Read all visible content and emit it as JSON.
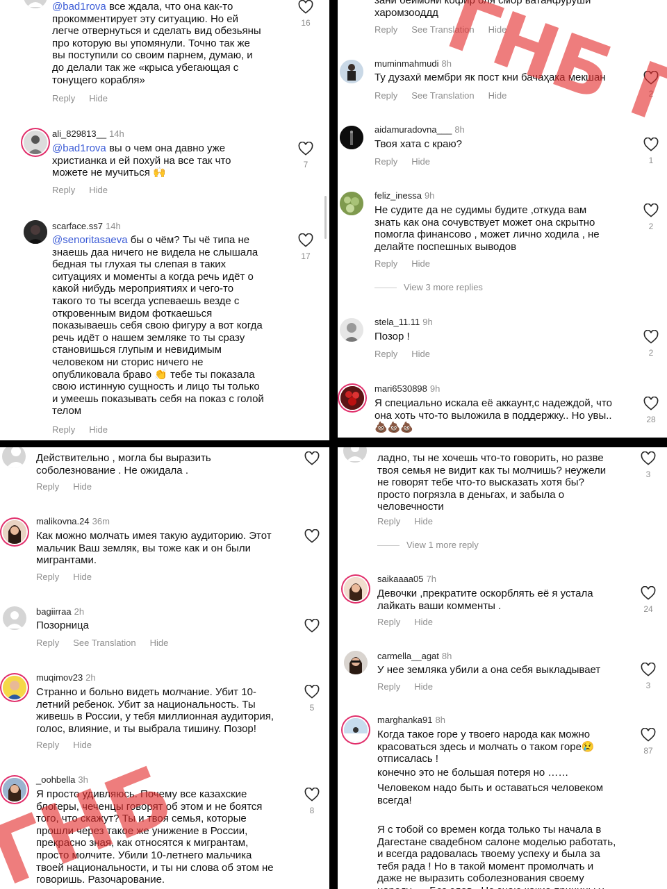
{
  "common": {
    "reply": "Reply",
    "hide": "Hide",
    "see_translation": "See Translation"
  },
  "p1": {
    "c1": {
      "mention": "@bad1rova",
      "text": " все ждала, что она как-то\nпрокомментирует эту ситуацию.  Но ей\nлегче отвернуться и сделать вид обезьяны\nпро которую вы упомянули. Точно так же\nвы поступили со своим парнем, думаю, и\nдо делали так же «крыса убегающая с\nтонущего корабля»",
      "likes": "16"
    },
    "c2": {
      "user": "ali_829813__",
      "time": "14h",
      "mention": "@bad1rova",
      "text": " вы о чем она давно уже\nхристианка и ей похуй на все так что\nможете не мучиться 🙌",
      "likes": "7"
    },
    "c3": {
      "user": "scarface.ss7",
      "time": "14h",
      "mention": "@senoritasaeva",
      "text": " бы о чём? Ты чё типа не\nзнаешь даа ничего не видела не слышала\nбедная ты глухая ты слепая в таких\nситуациях и моменты  а когда речь идёт о\nкакой нибудь мероприятиях и чего-то\nтакого то ты всегда успеваешь везде с\nоткровенным видом фоткаешься\nпоказываешь себя свою фигуру а вот когда\nречь идёт о нашем земляке то ты сразу\nстановишься глупым и невидимым\nчеловеком ни сторис ничего не\nопубликовала браво 👏 тебе ты показала\nсвою истинную сущность и лицо ты только\nи умеешь показывать себя на показ с голой\nтелом",
      "likes": "17"
    }
  },
  "p2": {
    "c0": {
      "text": "зани беимони кофир оля смор ватанфуруши\nхаромзооддд"
    },
    "c1": {
      "user": "muminmahmudi",
      "time": "8h",
      "text": "Ту дузахӣ мембри як пост кни бачаҳака мекшан",
      "likes": "2"
    },
    "c2": {
      "user": "aidamuradovna___",
      "time": "8h",
      "text": "Твоя хата с краю?",
      "likes": "1"
    },
    "c3": {
      "user": "feliz_inessa",
      "time": "9h",
      "text": "Не судите да не судимы будите ,откуда вам\nзнать как она сочувствует может она скрытно\nпомогла финансово , может лично ходила , не\nделайте поспешных выводов",
      "likes": "2",
      "more": "View 3 more replies"
    },
    "c4": {
      "user": "stela_11.11",
      "time": "9h",
      "text": "Позор !",
      "likes": "2"
    },
    "c5": {
      "user": "mari6530898",
      "time": "9h",
      "text": "Я специально искала её аккаунт,с надеждой, что\nона хоть что-то выложила в поддержку.. Но увы..\n💩💩💩",
      "likes": "28"
    }
  },
  "p3": {
    "c0": {
      "text": "Действительно , могла бы выразить\nсоболезнование . Не ожидала ."
    },
    "c1": {
      "user": "malikovna.24",
      "time": "36m",
      "text": "Как можно молчать имея такую аудиторию. Этот\nмальчик Ваш земляк, вы тоже как и он были\nмигрантами."
    },
    "c2": {
      "user": "bagiirraa",
      "time": "2h",
      "text": "Позорница"
    },
    "c3": {
      "user": "muqimov23",
      "time": "2h",
      "text": "Странно и больно видеть молчание. Убит 10-\nлетний ребенок. Убит за национальность. Ты\nживешь в России, у тебя миллионная аудитория,\nголос, влияние, и ты выбрала тишину. Позор!",
      "likes": "5"
    },
    "c4": {
      "user": "_oohbella",
      "time": "3h",
      "text": "Я просто удивляюсь. Почему все казахские\nблогеры, чеченцы говорят об этом и не боятся\nтого, что скажут? Ты и твоя семья, которые\nпрошли через такое же унижение в России,\nпрекрасно зная, как относятся к мигрантам,\nпросто молчите. Убили 10-летнего мальчика\nтвоей национальности, и ты ни слова об этом не\nговоришь. Разочарование.",
      "likes": "8"
    }
  },
  "p4": {
    "c0": {
      "text": "ладно, ты не хочешь что-то говорить, но разве\nтвоя семья не видит как ты молчишь? неужели\nне говорят тебе что-то высказать хотя бы?\nпросто погрязла в  деньгах, и забыла о\nчеловечности",
      "likes": "3",
      "more": "View 1 more reply"
    },
    "c1": {
      "user": "saikaaaa05",
      "time": "7h",
      "text": "Девочки ,прекратите оскорблять её я устала\nлайкать ваши комменты .",
      "likes": "24"
    },
    "c2": {
      "user": "carmella__agat",
      "time": "8h",
      "text": "У нее земляка убили а она себя выкладывает",
      "likes": "3"
    },
    "c3": {
      "user": "marghanka91",
      "time": "8h",
      "text": "Когда такое горе у твоего народа как можно\nкрасоваться здесь и молчать о таком горе😢\nотписалась !",
      "text2": "конечно это не большая потеря но ……",
      "text3": "Человеком надо быть и оставаться человеком\nвсегда!",
      "text4": "Я с тобой со времен когда только ты начала в\nДагестане свадебном салоне моделью работать,\nи всегда радовалась твоему успеху и была за\nтебя рада ! Но в такой момент промолчать и\nдаже не выразить соболезнования своему\nнароду. … Без слов . Не знаю какие причины у",
      "likes": "87"
    }
  },
  "watermark": {
    "top": "ГНБ ГН",
    "bottom": "ГНБ"
  },
  "colors": {
    "mention": "#3b5bd6",
    "watermark": "#e42d2d",
    "muted": "#8e8e8e"
  }
}
